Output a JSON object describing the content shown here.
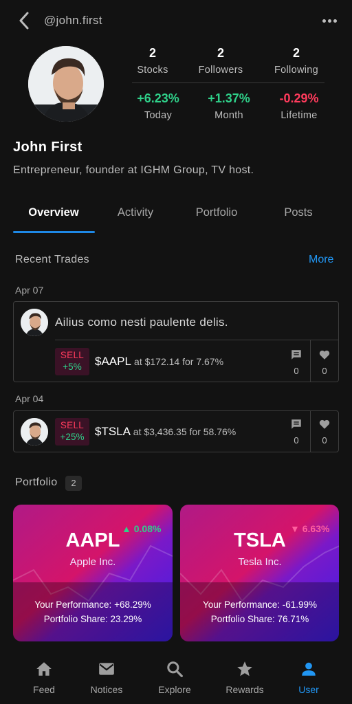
{
  "header": {
    "handle": "@john.first"
  },
  "profile": {
    "name": "John First",
    "bio": "Entrepreneur, founder at IGHM Group, TV host."
  },
  "stats": [
    {
      "value": "2",
      "label": "Stocks"
    },
    {
      "value": "2",
      "label": "Followers"
    },
    {
      "value": "2",
      "label": "Following"
    }
  ],
  "performance": [
    {
      "value": "+6.23%",
      "label": "Today",
      "trend": "up"
    },
    {
      "value": "+1.37%",
      "label": "Month",
      "trend": "up"
    },
    {
      "value": "-0.29%",
      "label": "Lifetime",
      "trend": "down"
    }
  ],
  "tabs": [
    {
      "label": "Overview",
      "active": true
    },
    {
      "label": "Activity",
      "active": false
    },
    {
      "label": "Portfolio",
      "active": false
    },
    {
      "label": "Posts",
      "active": false
    }
  ],
  "recent_trades": {
    "title": "Recent Trades",
    "more_label": "More",
    "trades": [
      {
        "date": "Apr 07",
        "comment": "Ailius como nesti paulente delis.",
        "action": "SELL",
        "change": "+5%",
        "ticker": "$AAPL",
        "detail": "at $172.14 for 7.67%",
        "comments": "0",
        "likes": "0"
      },
      {
        "date": "Apr 04",
        "comment": "",
        "action": "SELL",
        "change": "+25%",
        "ticker": "$TSLA",
        "detail": "at $3,436.35 for 58.76%",
        "comments": "0",
        "likes": "0"
      }
    ]
  },
  "portfolio": {
    "title": "Portfolio",
    "count": "2",
    "cards": [
      {
        "ticker": "AAPL",
        "company": "Apple Inc.",
        "change": "▲ 0.08%",
        "trend": "up",
        "perf_label": "Your Performance:",
        "perf_value": "+68.29%",
        "share_label": "Portfolio Share:",
        "share_value": "23.29%"
      },
      {
        "ticker": "TSLA",
        "company": "Tesla Inc.",
        "change": "▼ 6.63%",
        "trend": "down",
        "perf_label": "Your Performance:",
        "perf_value": "-61.99%",
        "share_label": "Portfolio Share:",
        "share_value": "76.71%"
      }
    ]
  },
  "nav": [
    {
      "label": "Feed",
      "icon": "home-icon",
      "active": false
    },
    {
      "label": "Notices",
      "icon": "mail-icon",
      "active": false
    },
    {
      "label": "Explore",
      "icon": "search-icon",
      "active": false
    },
    {
      "label": "Rewards",
      "icon": "star-icon",
      "active": false
    },
    {
      "label": "User",
      "icon": "user-icon",
      "active": true
    }
  ],
  "colors": {
    "background": "#121212",
    "accent": "#2196f3",
    "positive": "#2fd18a",
    "negative": "#ff3b5c"
  }
}
